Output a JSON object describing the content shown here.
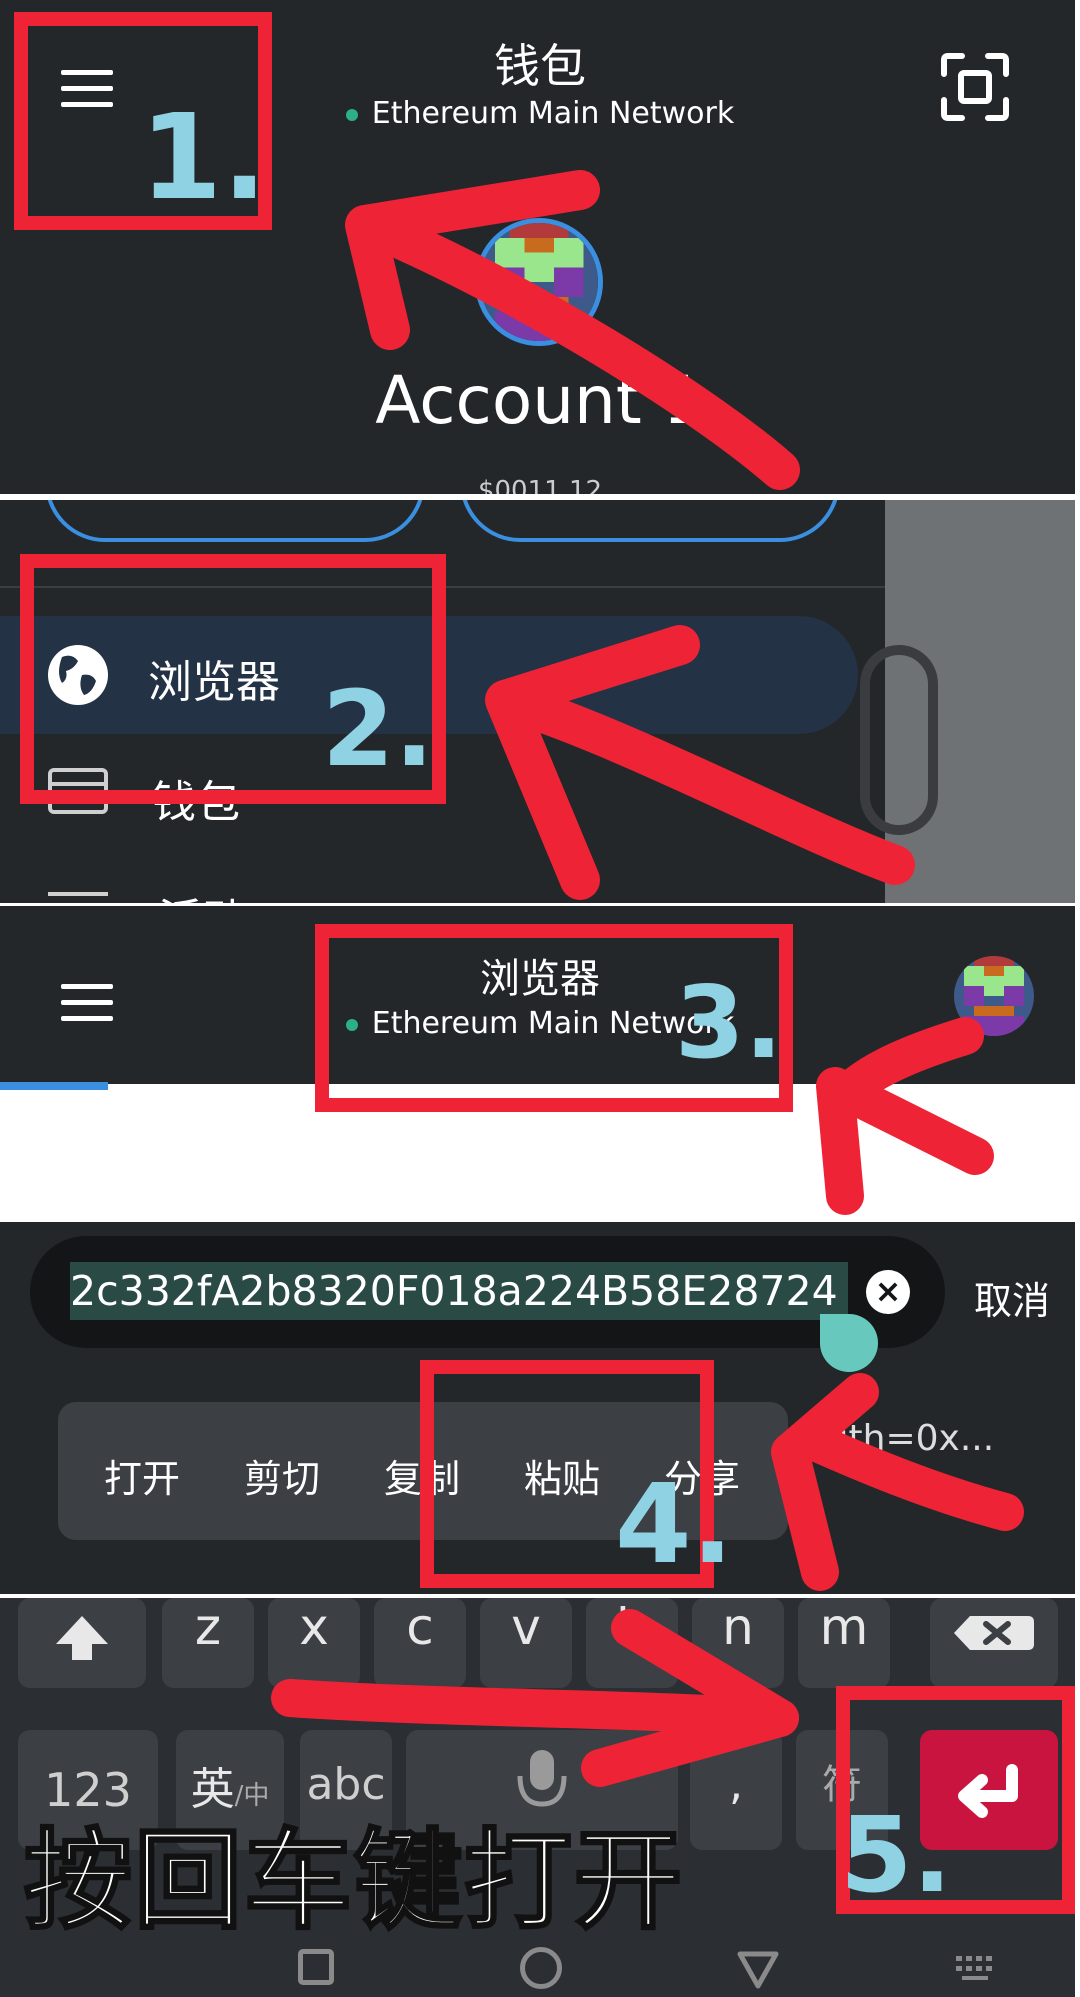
{
  "panel1": {
    "title": "钱包",
    "network": "Ethereum Main Network",
    "account_name": "Account 1",
    "balance_partial": "$0011.12",
    "step": "1."
  },
  "panel2": {
    "menu_items": [
      {
        "label": "浏览器",
        "icon": "globe-icon"
      },
      {
        "label": "钱包",
        "icon": "wallet-icon"
      },
      {
        "label": "活动",
        "icon": "list-icon"
      }
    ],
    "step": "2."
  },
  "panel3": {
    "title": "浏览器",
    "network": "Ethereum Main Network",
    "step": "3."
  },
  "panel4": {
    "url_value": "2c332fA2b8320F018a224B58E28724",
    "cancel_label": "取消",
    "context_menu": [
      "打开",
      "剪切",
      "复制",
      "粘贴",
      "分享"
    ],
    "suggestion_text": "?with=0x...",
    "step": "4."
  },
  "panel5": {
    "keys_row": [
      "z",
      "x",
      "c",
      "v",
      "b",
      "n",
      "m"
    ],
    "key_123": "123",
    "key_lang_main": "英",
    "key_lang_sub": "/中",
    "key_abc": "abc",
    "caption": "按回车键打开",
    "step": "5."
  },
  "colors": {
    "annotation_red": "#ee2436",
    "step_blue": "#8fd2e4",
    "panel_bg": "#24272a",
    "network_green": "#2bb089",
    "enter_key": "#c8143e"
  }
}
